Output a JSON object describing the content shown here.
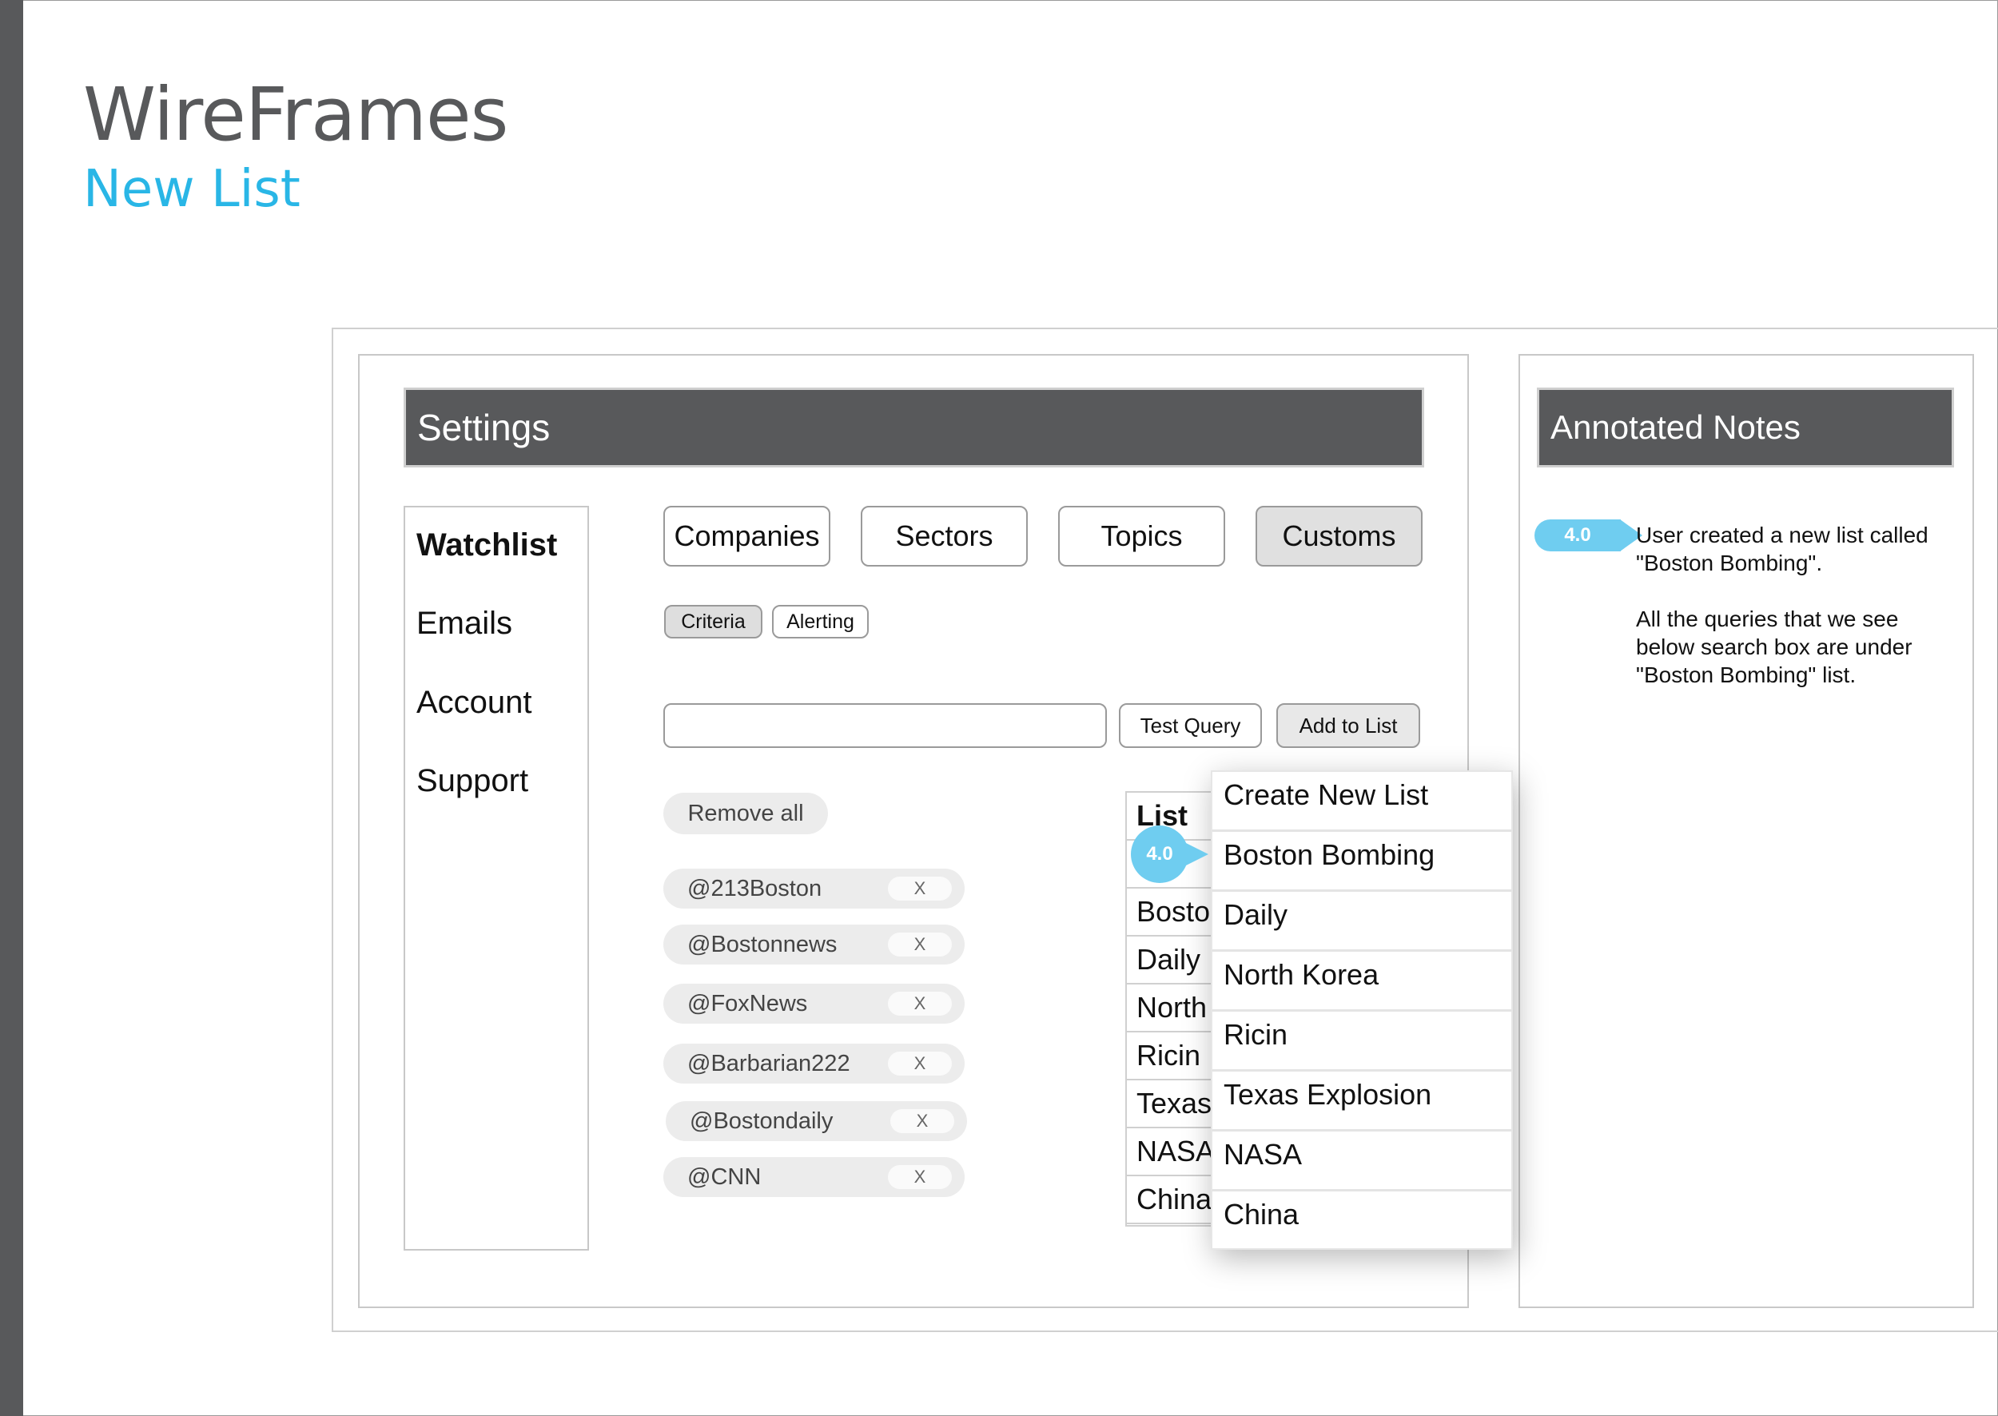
{
  "page": {
    "title": "WireFrames",
    "subtitle": "New List"
  },
  "settings": {
    "header": "Settings",
    "sidebar": [
      "Watchlist",
      "Emails",
      "Account",
      "Support"
    ],
    "active_sidebar_item": "Watchlist",
    "tabs": [
      "Companies",
      "Sectors",
      "Topics",
      "Customs"
    ],
    "active_tab": "Customs",
    "subtabs": [
      "Criteria",
      "Alerting"
    ],
    "active_subtab": "Criteria",
    "search": {
      "value": "",
      "placeholder": ""
    },
    "buttons": {
      "test_query": "Test Query",
      "add_to_list": "Add to List",
      "remove_all": "Remove all"
    },
    "chips": [
      {
        "label": "@213Boston",
        "remove": "X"
      },
      {
        "label": "@Bostonnews",
        "remove": "X"
      },
      {
        "label": "@FoxNews",
        "remove": "X"
      },
      {
        "label": "@Barbarian222",
        "remove": "X"
      },
      {
        "label": "@Bostondaily",
        "remove": "X"
      },
      {
        "label": "@CNN",
        "remove": "X"
      }
    ],
    "list_table": {
      "header": "List",
      "rows": [
        "Boston",
        "Daily",
        "North",
        "Ricin",
        "Texas",
        "NASA",
        "China"
      ]
    },
    "dropdown": [
      "Create New List",
      "Boston Bombing",
      "Daily",
      "North Korea",
      "Ricin",
      "Texas Explosion",
      "NASA",
      "China"
    ]
  },
  "notes": {
    "header": "Annotated Notes",
    "marker": "4.0",
    "paragraph_1": [
      "User created a new list called",
      "\"Boston Bombing\"."
    ],
    "paragraph_2": [
      "All the queries that we see",
      "below search box are under",
      "\"Boston Bombing\" list."
    ]
  },
  "colors": {
    "header_bg": "#58595b",
    "accent": "#29b6e6",
    "marker": "#6fcdf0",
    "active_tab_bg": "#e0e0e0",
    "chip_bg": "#ececec"
  },
  "icons": {
    "chip_remove": "x-mark",
    "marker": "callout-pointer"
  }
}
